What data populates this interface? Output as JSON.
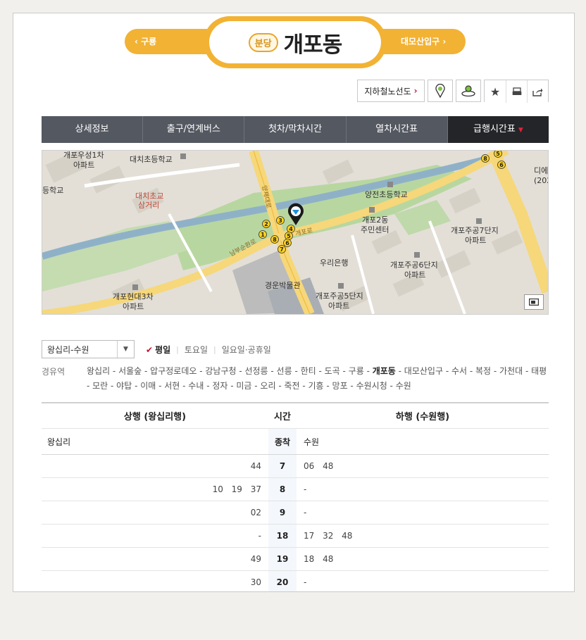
{
  "header": {
    "prev_station": "구룡",
    "next_station": "대모산입구",
    "line_badge": "분당",
    "station_name": "개포동"
  },
  "tools": {
    "route_map_label": "지하철노선도"
  },
  "tabs": [
    {
      "label": "상세정보"
    },
    {
      "label": "출구/연계버스"
    },
    {
      "label": "첫차/막차시간"
    },
    {
      "label": "열차시간표"
    },
    {
      "label": "급행시간표"
    }
  ],
  "map": {
    "labels": {
      "apt_gaepo_woosung1": "개포우성1차",
      "apt_gaepo_woosung1_b": "아파트",
      "school_daechi": "대치초등학교",
      "school_left": "등학교",
      "intersection_daechi": "대치초교",
      "intersection_daechi_b": "삼거리",
      "road_yangjae": "양재대로",
      "road_gaepo": "개포로",
      "road_nambu": "남부순환로",
      "school_yangjeon": "양전초등학교",
      "center_gaepo2": "개포2동",
      "center_gaepo2_b": "주민센터",
      "bank_woori": "우리은행",
      "museum_gyeongun": "경운박물관",
      "apt_jugong7": "개포주공7단지",
      "apt_jugong7_b": "아파트",
      "apt_jugong6": "개포주공6단지",
      "apt_jugong6_b": "아파트",
      "apt_jugong5": "개포주공5단지",
      "apt_jugong5_b": "아파트",
      "apt_hyundai3": "개포현대3차",
      "apt_hyundai3_b": "아파트",
      "edge_right": "디에",
      "edge_right_b": "(202"
    },
    "exits_main": [
      "1",
      "2",
      "3",
      "4",
      "5",
      "6",
      "7",
      "8"
    ],
    "exits_corner": [
      "5",
      "8",
      "6"
    ]
  },
  "filters": {
    "route_select": "왕십리-수원",
    "days": [
      "평일",
      "토요일",
      "일요일·공휴일"
    ],
    "active_day": "평일"
  },
  "via": {
    "label": "경유역",
    "stations_before": "왕십리 - 서울숲 - 압구정로데오 - 강남구청 - 선정릉 - 선릉 - 한티 - 도곡 - 구룡 - ",
    "current": "개포동",
    "stations_after": " - 대모산입구 - 수서 - 복정 - 가천대 - 태평 - 모란 - 야탑 - 이매 - 서현 - 수내 - 정자 - 미금 - 오리 - 죽전 - 기흥 - 망포 - 수원시청 - 수원"
  },
  "timetable": {
    "headers": {
      "up": "상행 (왕십리행)",
      "hour": "시간",
      "down": "하행 (수원행)"
    },
    "terminal": {
      "up": "왕십리",
      "hour": "종착",
      "down": "수원"
    },
    "rows": [
      {
        "up": "44",
        "hour": "7",
        "down": "06 48"
      },
      {
        "up": "10 19 37",
        "hour": "8",
        "down": "-"
      },
      {
        "up": "02",
        "hour": "9",
        "down": "-"
      },
      {
        "up": "-",
        "hour": "18",
        "down": "17 32 48"
      },
      {
        "up": "49",
        "hour": "19",
        "down": "18 48"
      },
      {
        "up": "30",
        "hour": "20",
        "down": "-"
      }
    ]
  }
}
